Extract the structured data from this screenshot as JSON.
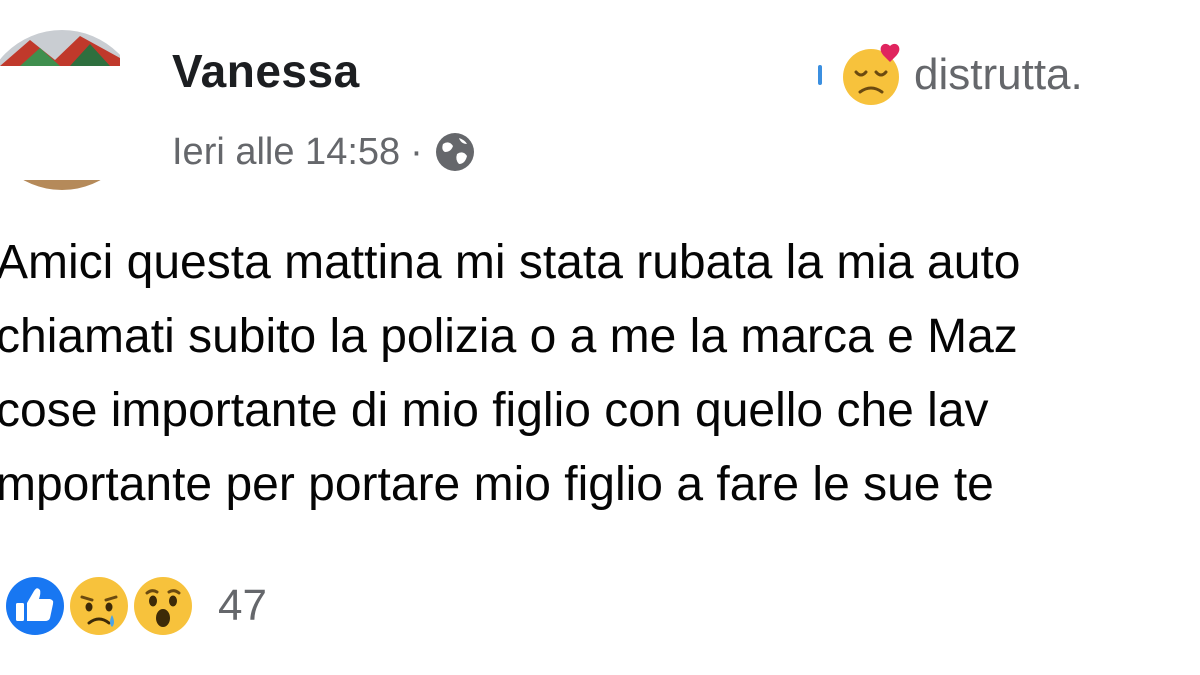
{
  "post": {
    "author": "Vanessa",
    "feeling": {
      "emoji": "sad-face-with-heart-icon",
      "text": "distrutta."
    },
    "timestamp": "Ieri alle 14:58",
    "separator": "·",
    "privacy_icon": "globe-icon",
    "lines": [
      "Amici questa mattina mi stata rubata la mia auto",
      "chiamati subito la polizia o a me la marca e Maz",
      "cose importante di mio figlio con quello che lav",
      "mportante per portare mio figlio a fare le sue te"
    ],
    "reactions": {
      "icons": [
        "like-icon",
        "sad-icon",
        "wow-icon"
      ],
      "count": "47"
    }
  },
  "colors": {
    "like_blue": "#1877f2",
    "emoji_yellow": "#f7c23c",
    "secondary_text": "#65676b"
  }
}
